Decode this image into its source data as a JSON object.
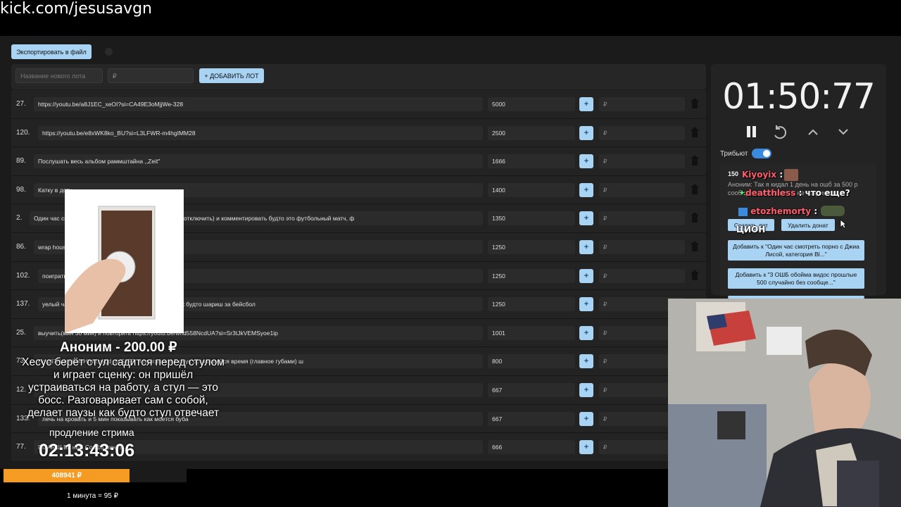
{
  "browser": {
    "url": "kick.com/jesusavgn"
  },
  "toolbar": {
    "export_label": "Экспортировать в файл"
  },
  "new_lot": {
    "name_placeholder": "Название нового лота",
    "amount_placeholder": "₽",
    "add_label": "+ ДОБАВИТЬ ЛОТ"
  },
  "lots": [
    {
      "num": "27.",
      "title": "https://youtu.be/a8J1EC_xeOI?si=CA49E3oMjjWe-328",
      "amount": "5000",
      "plus": "+",
      "rub": "₽"
    },
    {
      "num": "120.",
      "title": "https://youtu.be/e8xWK8ko_BU?si=L3LFWR-m4hgIMM28",
      "amount": "2500",
      "plus": "+",
      "rub": "₽"
    },
    {
      "num": "89.",
      "title": "Послушать весь альбом раммштайна ,,Zeit\"",
      "amount": "1666",
      "plus": "+",
      "rub": "₽"
    },
    {
      "num": "98.",
      "title": "Катку в доту",
      "amount": "1400",
      "plus": "+",
      "rub": "₽"
    },
    {
      "num": "2.",
      "title": "Один час см                                                          lacked Raw (экран либо заблюрить либо отключить) и комментировать будто это футбольный матч, ф",
      "amount": "1350",
      "plus": "+",
      "rub": "₽"
    },
    {
      "num": "86.",
      "title": "wrap house                                                          ловек для игры",
      "amount": "1250",
      "plus": "+",
      "rub": "₽"
    },
    {
      "num": "102.",
      "title": "поиграть",
      "amount": "1250",
      "plus": "+",
      "rub": "₽"
    },
    {
      "num": "137.",
      "title": "уелый ча                                                          сокс и восхищатся всеми действиями как будто шариш за бейсбол",
      "amount": "1250",
      "plus": "+",
      "rub": "₽"
    },
    {
      "num": "25.",
      "title": "выучить(мин 30 мин) и повторить https://youtu.be/wnd558NcdUA?si=Sr3tJkVEMSyoe1ip",
      "amount": "1001",
      "plus": "+",
      "rub": "₽"
    },
    {
      "num": "73.",
      "title": "По                                                     pli7Hcjps&si=Hhwl.migd_tlxSgFR и поиграть в 7 days оставшиейся время (главное губами) ш",
      "amount": "800",
      "plus": "+",
      "rub": "₽"
    },
    {
      "num": "12.",
      "title": "",
      "amount": "667",
      "plus": "+",
      "rub": "₽"
    },
    {
      "num": "133.",
      "title": "лечь на кровать и 5 мин показывать как моется буба",
      "amount": "667",
      "plus": "+",
      "rub": "₽"
    },
    {
      "num": "77.",
      "title": "По                   Ан         Ш         Ви              ный Сок 10 минут",
      "amount": "666",
      "plus": "+",
      "rub": "₽"
    }
  ],
  "timer": {
    "value": "01:50:77"
  },
  "tribute": {
    "label": "Трибьют"
  },
  "donation": {
    "amount": "150",
    "text": "Аноним: Так я кидал 1 день на ошб за 500 р                       сообщения отправи ты не соединил их",
    "create_label": "Создать лот",
    "delete_label": "Удалить донат",
    "add_btn_1": "Добавить к \"Один час смотреть порно с Джиа Лисой, категория Bl...\"",
    "add_btn_2": "Добавить к \"3 ОШБ обойма видос прошлые 500 случайно без сообще...\""
  },
  "chat": [
    {
      "nick": "Kiyoyix",
      "msg": ":"
    },
    {
      "nick": "deatthless",
      "msg": ": что еще?"
    },
    {
      "nick": "etozhemorty",
      "msg": ":"
    },
    {
      "nick": "",
      "msg": "ЦИОН"
    }
  ],
  "alert": {
    "title": "Аноним - 200.00 ₽",
    "message": "Хесус берёт стул садится перед стулом и играет сценку: он пришёл устраиваться на работу, а стул — это босс. Разговаривает сам с собой, делает паузы как будто стул отвечает",
    "ext_label": "продление стрима",
    "ext_time": "02:13:43:06"
  },
  "progress": {
    "label": "408941 ₽",
    "fill_fraction": 0.69
  },
  "rate": {
    "label": "1 минута = 95 ₽"
  },
  "colors": {
    "accent": "#a9d3f3",
    "progress": "#f59a23",
    "nick": "#ff5d6a",
    "toggle": "#3a8be0"
  }
}
